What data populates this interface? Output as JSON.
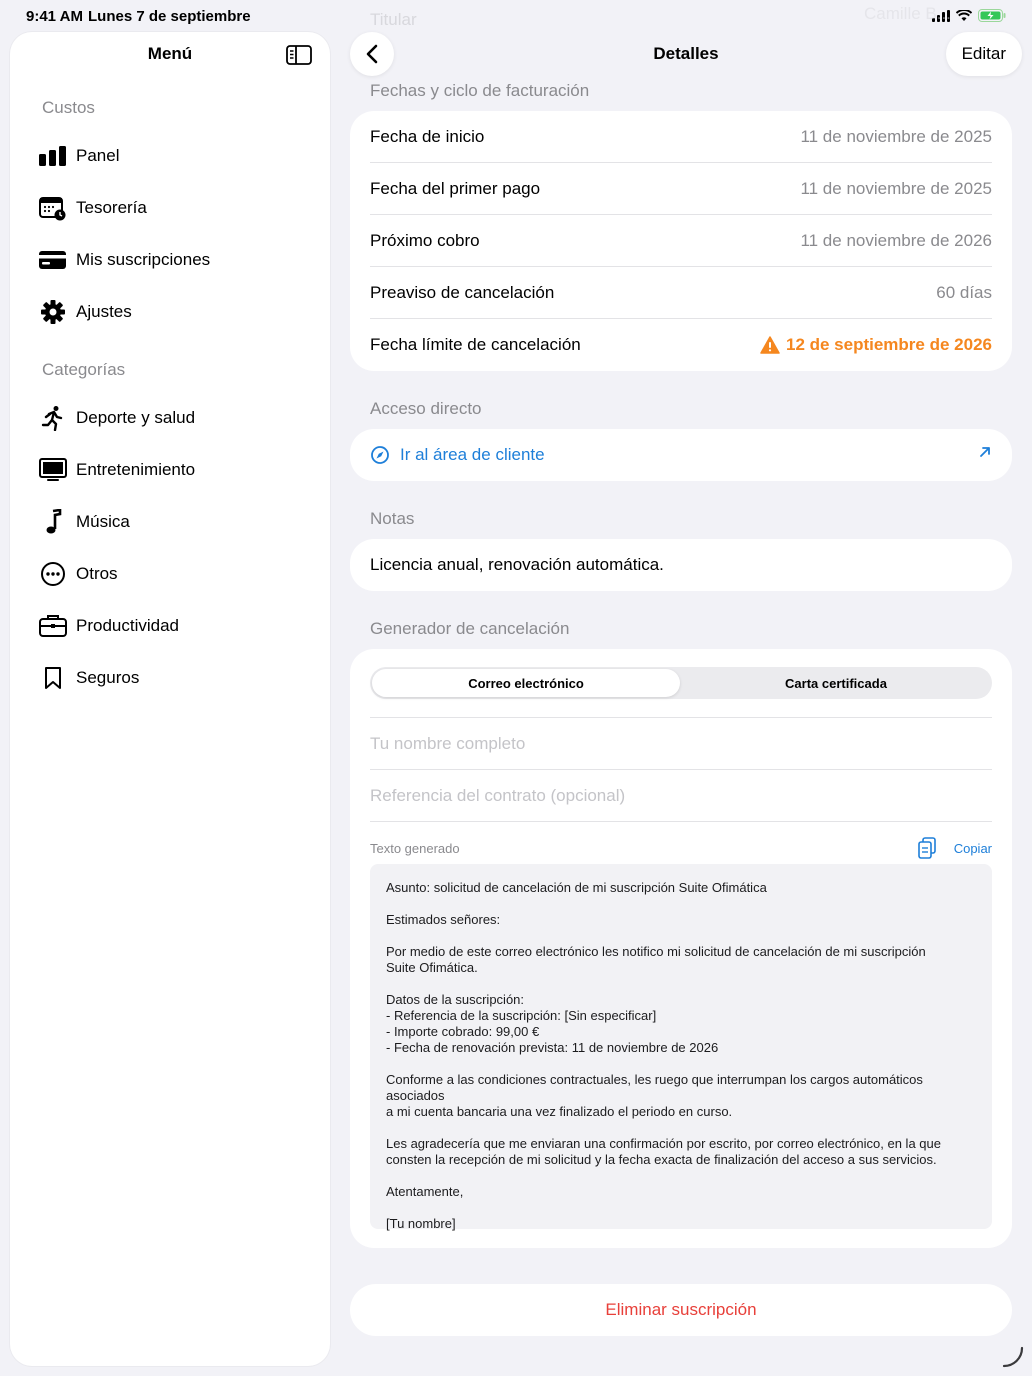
{
  "status": {
    "time": "9:41 AM",
    "date": "Lunes 7 de septiembre"
  },
  "sidebar": {
    "title": "Menú",
    "section1": "Custos",
    "section2": "Categorías",
    "items": [
      {
        "label": "Panel",
        "icon": "chart-bar-icon"
      },
      {
        "label": "Tesorería",
        "icon": "calendar-clock-icon"
      },
      {
        "label": "Mis suscripciones",
        "icon": "credit-card-icon"
      },
      {
        "label": "Ajustes",
        "icon": "gear-icon"
      }
    ],
    "categories": [
      {
        "label": "Deporte y salud",
        "icon": "running-icon"
      },
      {
        "label": "Entretenimiento",
        "icon": "tv-icon"
      },
      {
        "label": "Música",
        "icon": "music-note-icon"
      },
      {
        "label": "Otros",
        "icon": "ellipsis-circle-icon"
      },
      {
        "label": "Productividad",
        "icon": "briefcase-icon"
      },
      {
        "label": "Seguros",
        "icon": "bookmark-icon"
      }
    ]
  },
  "nav": {
    "title": "Detalles",
    "edit": "Editar",
    "ghost_left": "Titular",
    "ghost_right": "Camille B..."
  },
  "billing": {
    "label": "Fechas y ciclo de facturación",
    "rows": [
      {
        "label": "Fecha de inicio",
        "value": "11 de noviembre de 2025"
      },
      {
        "label": "Fecha del primer pago",
        "value": "11 de noviembre de 2025"
      },
      {
        "label": "Próximo cobro",
        "value": "11 de noviembre de 2026"
      },
      {
        "label": "Preaviso de cancelación",
        "value": "60 días"
      },
      {
        "label": "Fecha límite de cancelación",
        "value": "12 de septiembre de 2026"
      }
    ]
  },
  "access": {
    "label": "Acceso directo",
    "link": "Ir al área de cliente"
  },
  "notes": {
    "label": "Notas",
    "text": "Licencia anual, renovación automática."
  },
  "generator": {
    "label": "Generador de cancelación",
    "tabs": [
      "Correo electrónico",
      "Carta certificada"
    ],
    "name_placeholder": "Tu nombre completo",
    "ref_placeholder": "Referencia del contrato (opcional)",
    "generated_label": "Texto generado",
    "copy": "Copiar",
    "letter": [
      "Asunto: solicitud de cancelación de mi suscripción Suite Ofimática",
      "",
      "Estimados señores:",
      "",
      "Por medio de este correo electrónico les notifico mi solicitud de cancelación de mi suscripción",
      "Suite Ofimática.",
      "",
      "Datos de la suscripción:",
      "- Referencia de la suscripción: [Sin especificar]",
      "- Importe cobrado: 99,00 €",
      "- Fecha de renovación prevista: 11 de noviembre de 2026",
      "",
      "Conforme a las condiciones contractuales, les ruego que interrumpan los cargos automáticos asociados",
      "a mi cuenta bancaria una vez finalizado el periodo en curso.",
      "",
      "Les agradecería que me enviaran una confirmación por escrito, por correo electrónico, en la que",
      "consten la recepción de mi solicitud y la fecha exacta de finalización del acceso a sus servicios.",
      "",
      "Atentamente,",
      "",
      "[Tu nombre]"
    ]
  },
  "delete": "Eliminar suscripción",
  "colors": {
    "accent": "#1e7fd9",
    "warning": "#f5871f",
    "destructive": "#e8403a",
    "background": "#f2f2f7"
  }
}
